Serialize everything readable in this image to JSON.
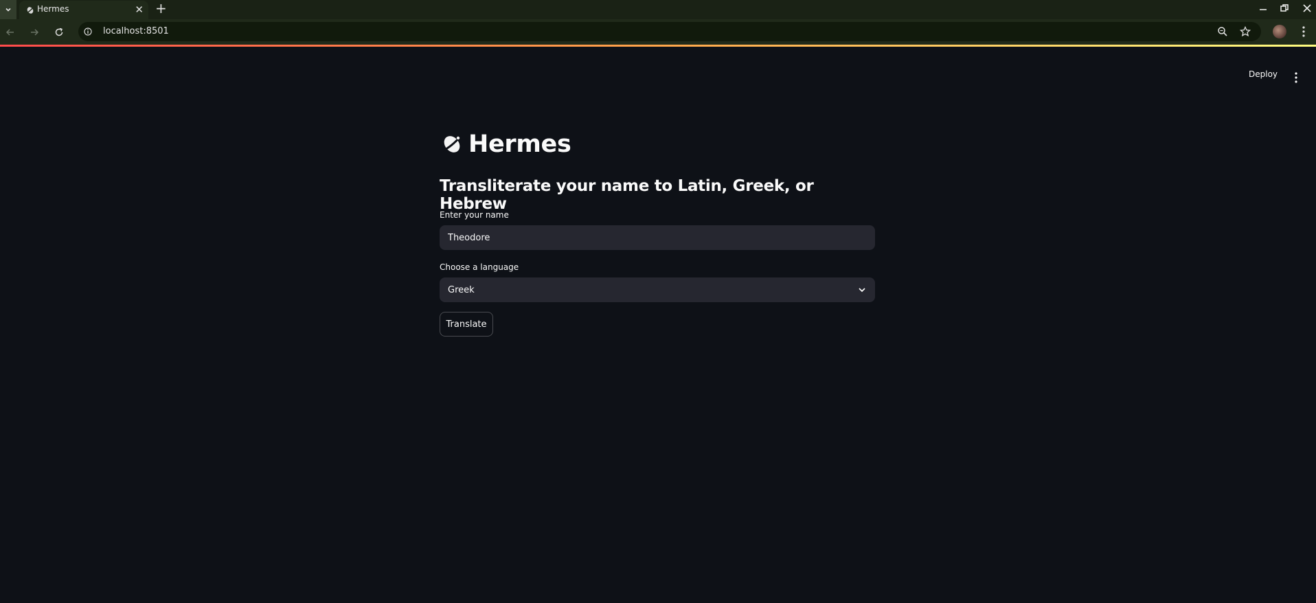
{
  "browser": {
    "tab_title": "Hermes",
    "url": "localhost:8501",
    "tab_icon": "satellite-dish-icon",
    "accent_gradient": [
      "#ff4b4b",
      "#ffa64a",
      "#fffd80"
    ]
  },
  "app": {
    "deploy_label": "Deploy",
    "title": "Hermes",
    "title_icon": "satellite-icon",
    "subtitle": "Transliterate your name to Latin, Greek, or Hebrew",
    "name_field": {
      "label": "Enter your name",
      "value": "Theodore"
    },
    "language_select": {
      "label": "Choose a language",
      "selected": "Greek"
    },
    "translate_button": "Translate"
  },
  "colors": {
    "background": "#0e1117",
    "input_bg": "#262730",
    "text": "#fafafa"
  }
}
